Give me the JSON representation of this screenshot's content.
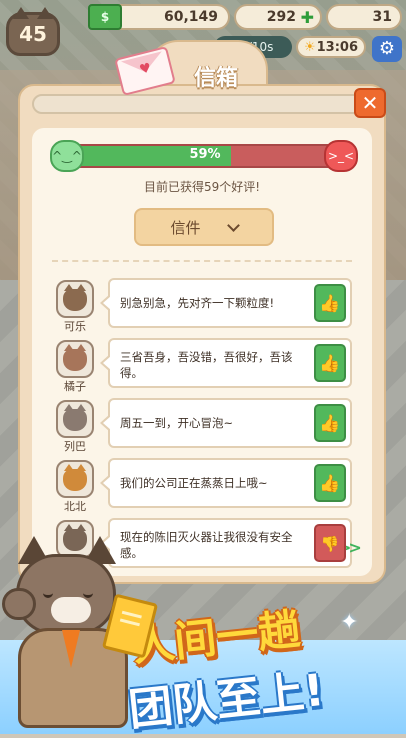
{
  "hud": {
    "level": "45",
    "cash": "60,149",
    "gems": "292",
    "gold": "31",
    "task": "35/10s",
    "time": "13:06",
    "icons": {
      "cash": "cash-icon",
      "gem": "plus-icon",
      "sun": "sun-icon",
      "settings": "gear-icon"
    }
  },
  "mailbox": {
    "title": "信箱",
    "close_glyph": "✕",
    "progress_percent": 59,
    "progress_label": "59%",
    "summary": "目前已获得59个好评!",
    "dropdown_label": "信件",
    "colors": {
      "positive": "#52b85c",
      "negative": "#c95d5d",
      "accent": "#ee6a2e"
    }
  },
  "reviews": [
    {
      "name": "可乐",
      "text": "别急别急，先对齐一下颗粒度!",
      "rating": "like",
      "fur": "#8b6a4f"
    },
    {
      "name": "橘子",
      "text": "三省吾身，吾没错，吾很好，吾该得。",
      "rating": "like",
      "fur": "#a7755a"
    },
    {
      "name": "列巴",
      "text": "周五一到，开心冒泡~",
      "rating": "like",
      "fur": "#8a7a70"
    },
    {
      "name": "北北",
      "text": "我们的公司正在蒸蒸日上哦~",
      "rating": "like",
      "fur": "#d08a3a"
    },
    {
      "name": "",
      "text": "现在的陈旧灭火器让我很没有安全感。",
      "rating": "dislike",
      "fur": "#7a6656"
    }
  ],
  "promo": {
    "line1": "人间一趟",
    "line2": "团队至上!"
  }
}
